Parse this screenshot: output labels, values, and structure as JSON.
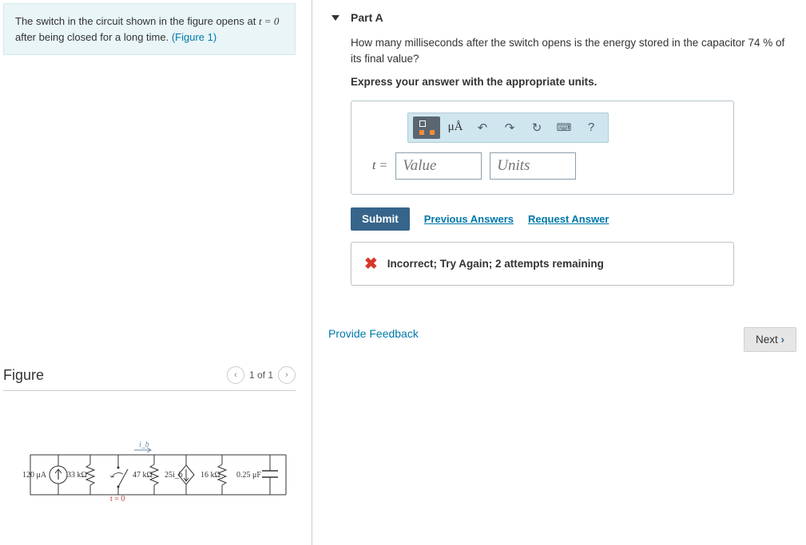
{
  "problem": {
    "line1": "The switch in the circuit shown in the figure opens at ",
    "var": "t = 0",
    "line2": " after being closed for a long time. ",
    "fig_ref": "(Figure 1)"
  },
  "figure": {
    "title": "Figure",
    "pager": "1 of 1"
  },
  "circuit": {
    "source": "120 μA",
    "r1": "33 kΩ",
    "r2": "47 kΩ",
    "dep_source": "25i_b",
    "r3": "16 kΩ",
    "cap": "0.25 μF",
    "switch_label": "t = 0",
    "current_label": "i_b"
  },
  "part": {
    "label": "Part A",
    "question": "How many milliseconds after the switch opens is the energy stored in the capacitor 74 % of its final value?",
    "instruction": "Express your answer with the appropriate units."
  },
  "toolbar": {
    "units_btn": "μÅ",
    "undo": "↶",
    "redo": "↷",
    "reset": "↻",
    "keyboard": "⌨",
    "help": "?"
  },
  "answer": {
    "var_label": "t =",
    "value_placeholder": "Value",
    "units_placeholder": "Units"
  },
  "actions": {
    "submit": "Submit",
    "prev_answers": "Previous Answers",
    "request_answer": "Request Answer"
  },
  "feedback": {
    "text": "Incorrect; Try Again; 2 attempts remaining"
  },
  "footer": {
    "provide_feedback": "Provide Feedback",
    "next": "Next"
  }
}
